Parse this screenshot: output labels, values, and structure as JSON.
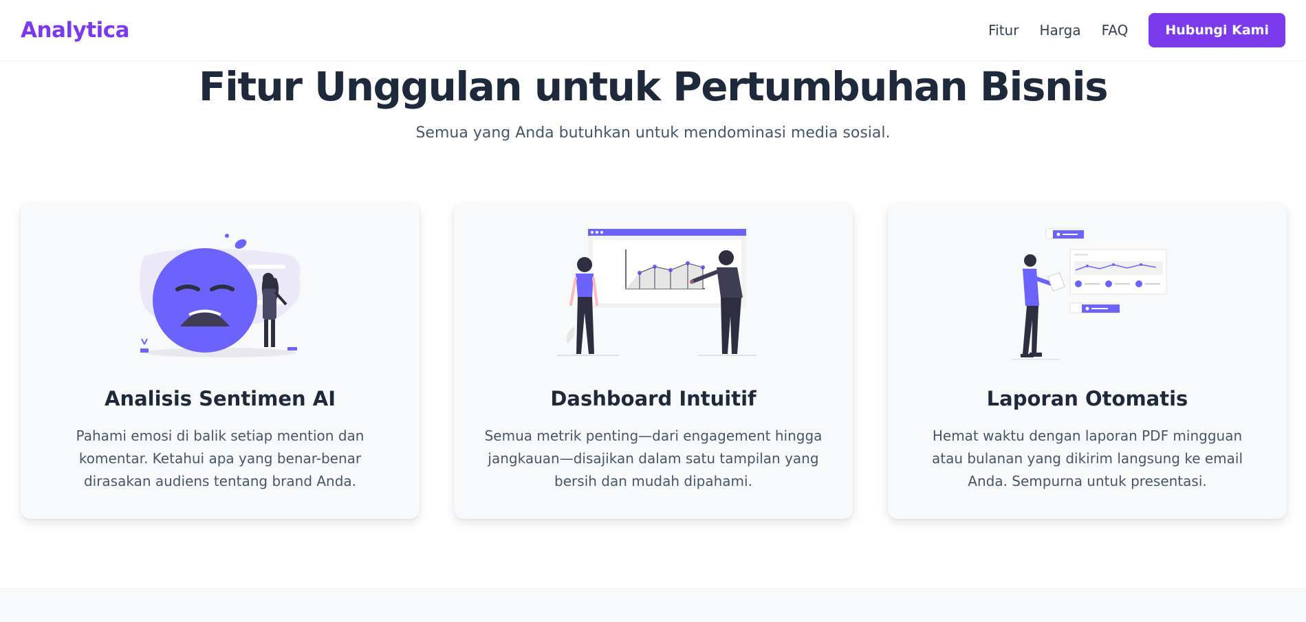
{
  "nav": {
    "brand": "Analytica",
    "links": [
      "Fitur",
      "Harga",
      "FAQ"
    ],
    "cta": "Hubungi Kami"
  },
  "hero": {
    "title": "Fitur Unggulan untuk Pertumbuhan Bisnis",
    "subtitle": "Semua yang Anda butuhkan untuk mendominasi media sosial."
  },
  "features": [
    {
      "title": "Analisis Sentimen AI",
      "description": "Pahami emosi di balik setiap mention dan komentar. Ketahui apa yang benar-benar dirasakan audiens tentang brand Anda.",
      "illustration": "sad-face-woman-illustration"
    },
    {
      "title": "Dashboard Intuitif",
      "description": "Semua metrik penting—dari engagement hingga jangkauan—disajikan dalam satu tampilan yang bersih dan mudah dipahami.",
      "illustration": "presentation-chart-illustration"
    },
    {
      "title": "Laporan Otomatis",
      "description": "Hemat waktu dengan laporan PDF mingguan atau bulanan yang dikirim langsung ke email Anda. Sempurna untuk presentasi.",
      "illustration": "report-reading-illustration"
    }
  ],
  "colors": {
    "brand": "#7c3aed",
    "illustration_accent": "#6c63ff",
    "text_dark": "#1e293b",
    "text_muted": "#475569"
  }
}
